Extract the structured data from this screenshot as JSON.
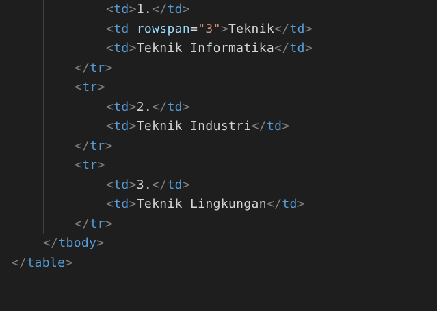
{
  "colors": {
    "background": "#1e1e1e",
    "bracket": "#808080",
    "tag": "#569cd6",
    "attribute": "#9cdcfe",
    "string": "#ce9178",
    "text": "#d4d4d4",
    "indent_guide": "#404040"
  },
  "lines": [
    [
      [
        "bracket",
        "<"
      ],
      [
        "tag",
        "td"
      ],
      [
        "bracket",
        ">"
      ],
      [
        "text",
        "1."
      ],
      [
        "bracket",
        "</"
      ],
      [
        "tag",
        "td"
      ],
      [
        "bracket",
        ">"
      ]
    ],
    [
      [
        "bracket",
        "<"
      ],
      [
        "tag",
        "td"
      ],
      [
        "text",
        " "
      ],
      [
        "attr",
        "rowspan"
      ],
      [
        "eq",
        "="
      ],
      [
        "str",
        "\"3\""
      ],
      [
        "bracket",
        ">"
      ],
      [
        "text",
        "Teknik"
      ],
      [
        "bracket",
        "</"
      ],
      [
        "tag",
        "td"
      ],
      [
        "bracket",
        ">"
      ]
    ],
    [
      [
        "bracket",
        "<"
      ],
      [
        "tag",
        "td"
      ],
      [
        "bracket",
        ">"
      ],
      [
        "text",
        "Teknik Informatika"
      ],
      [
        "bracket",
        "</"
      ],
      [
        "tag",
        "td"
      ],
      [
        "bracket",
        ">"
      ]
    ],
    [
      [
        "bracket",
        "</"
      ],
      [
        "tag",
        "tr"
      ],
      [
        "bracket",
        ">"
      ]
    ],
    [
      [
        "bracket",
        "<"
      ],
      [
        "tag",
        "tr"
      ],
      [
        "bracket",
        ">"
      ]
    ],
    [
      [
        "bracket",
        "<"
      ],
      [
        "tag",
        "td"
      ],
      [
        "bracket",
        ">"
      ],
      [
        "text",
        "2."
      ],
      [
        "bracket",
        "</"
      ],
      [
        "tag",
        "td"
      ],
      [
        "bracket",
        ">"
      ]
    ],
    [
      [
        "bracket",
        "<"
      ],
      [
        "tag",
        "td"
      ],
      [
        "bracket",
        ">"
      ],
      [
        "text",
        "Teknik Industri"
      ],
      [
        "bracket",
        "</"
      ],
      [
        "tag",
        "td"
      ],
      [
        "bracket",
        ">"
      ]
    ],
    [
      [
        "bracket",
        "</"
      ],
      [
        "tag",
        "tr"
      ],
      [
        "bracket",
        ">"
      ]
    ],
    [
      [
        "bracket",
        "<"
      ],
      [
        "tag",
        "tr"
      ],
      [
        "bracket",
        ">"
      ]
    ],
    [
      [
        "bracket",
        "<"
      ],
      [
        "tag",
        "td"
      ],
      [
        "bracket",
        ">"
      ],
      [
        "text",
        "3."
      ],
      [
        "bracket",
        "</"
      ],
      [
        "tag",
        "td"
      ],
      [
        "bracket",
        ">"
      ]
    ],
    [
      [
        "bracket",
        "<"
      ],
      [
        "tag",
        "td"
      ],
      [
        "bracket",
        ">"
      ],
      [
        "text",
        "Teknik Lingkungan"
      ],
      [
        "bracket",
        "</"
      ],
      [
        "tag",
        "td"
      ],
      [
        "bracket",
        ">"
      ]
    ],
    [
      [
        "bracket",
        "</"
      ],
      [
        "tag",
        "tr"
      ],
      [
        "bracket",
        ">"
      ]
    ],
    [
      [
        "bracket",
        "</"
      ],
      [
        "tag",
        "tbody"
      ],
      [
        "bracket",
        ">"
      ]
    ],
    [
      [
        "bracket",
        "</"
      ],
      [
        "tag",
        "table"
      ],
      [
        "bracket",
        ">"
      ]
    ]
  ]
}
